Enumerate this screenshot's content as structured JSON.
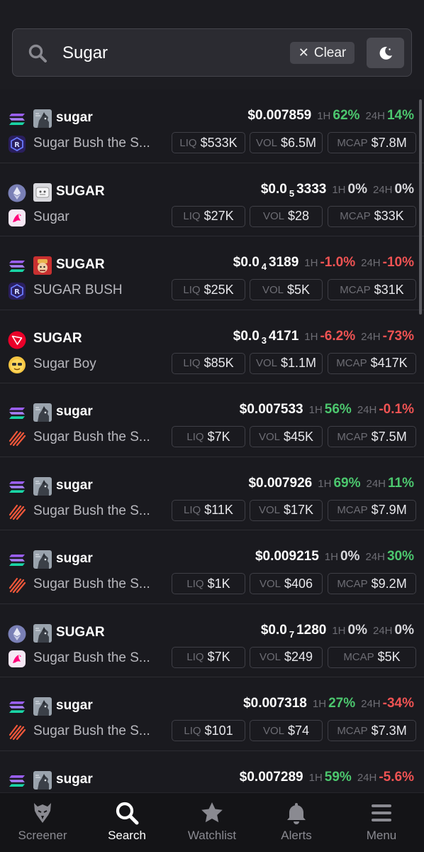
{
  "search": {
    "query": "Sugar",
    "clear_label": "Clear"
  },
  "rows": [
    {
      "chain": "solana",
      "dex": "raydium",
      "token_img": "dog",
      "symbol": "sugar",
      "name": "Sugar Bush the S...",
      "price_prefix": "$0.007859",
      "price_sub": "",
      "price_suffix": "",
      "h1_label": "1H",
      "h1": "62%",
      "h1_class": "pos",
      "h24_label": "24H",
      "h24": "14%",
      "h24_class": "pos",
      "liq_label": "LIQ",
      "liq": "$533K",
      "vol_label": "VOL",
      "vol": "$6.5M",
      "mcap_label": "MCAP",
      "mcap": "$7.8M"
    },
    {
      "chain": "ethereum",
      "dex": "uniswap",
      "token_img": "gray",
      "symbol": "SUGAR",
      "name": "Sugar",
      "price_prefix": "$0.0",
      "price_sub": "5",
      "price_suffix": "3333",
      "h1_label": "1H",
      "h1": "0%",
      "h1_class": "zero",
      "h24_label": "24H",
      "h24": "0%",
      "h24_class": "zero",
      "liq_label": "LIQ",
      "liq": "$27K",
      "vol_label": "VOL",
      "vol": "$28",
      "mcap_label": "MCAP",
      "mcap": "$33K"
    },
    {
      "chain": "solana",
      "dex": "raydium",
      "token_img": "red",
      "symbol": "SUGAR",
      "name": "SUGAR BUSH",
      "price_prefix": "$0.0",
      "price_sub": "4",
      "price_suffix": "3189",
      "h1_label": "1H",
      "h1": "-1.0%",
      "h1_class": "neg",
      "h24_label": "24H",
      "h24": "-10%",
      "h24_class": "neg",
      "liq_label": "LIQ",
      "liq": "$25K",
      "vol_label": "VOL",
      "vol": "$5K",
      "mcap_label": "MCAP",
      "mcap": "$31K"
    },
    {
      "chain": "tron",
      "dex": "sunpump",
      "token_img": "",
      "symbol": "SUGAR",
      "name": "Sugar Boy",
      "price_prefix": "$0.0",
      "price_sub": "3",
      "price_suffix": "4171",
      "h1_label": "1H",
      "h1": "-6.2%",
      "h1_class": "neg",
      "h24_label": "24H",
      "h24": "-73%",
      "h24_class": "neg",
      "liq_label": "LIQ",
      "liq": "$85K",
      "vol_label": "VOL",
      "vol": "$1.1M",
      "mcap_label": "MCAP",
      "mcap": "$417K"
    },
    {
      "chain": "solana",
      "dex": "meteora",
      "token_img": "dog",
      "symbol": "sugar",
      "name": "Sugar Bush the S...",
      "price_prefix": "$0.007533",
      "price_sub": "",
      "price_suffix": "",
      "h1_label": "1H",
      "h1": "56%",
      "h1_class": "pos",
      "h24_label": "24H",
      "h24": "-0.1%",
      "h24_class": "neg",
      "liq_label": "LIQ",
      "liq": "$7K",
      "vol_label": "VOL",
      "vol": "$45K",
      "mcap_label": "MCAP",
      "mcap": "$7.5M"
    },
    {
      "chain": "solana",
      "dex": "meteora",
      "token_img": "dog",
      "symbol": "sugar",
      "name": "Sugar Bush the S...",
      "price_prefix": "$0.007926",
      "price_sub": "",
      "price_suffix": "",
      "h1_label": "1H",
      "h1": "69%",
      "h1_class": "pos",
      "h24_label": "24H",
      "h24": "11%",
      "h24_class": "pos",
      "liq_label": "LIQ",
      "liq": "$11K",
      "vol_label": "VOL",
      "vol": "$17K",
      "mcap_label": "MCAP",
      "mcap": "$7.9M"
    },
    {
      "chain": "solana",
      "dex": "meteora",
      "token_img": "dog",
      "symbol": "sugar",
      "name": "Sugar Bush the S...",
      "price_prefix": "$0.009215",
      "price_sub": "",
      "price_suffix": "",
      "h1_label": "1H",
      "h1": "0%",
      "h1_class": "zero",
      "h24_label": "24H",
      "h24": "30%",
      "h24_class": "pos",
      "liq_label": "LIQ",
      "liq": "$1K",
      "vol_label": "VOL",
      "vol": "$406",
      "mcap_label": "MCAP",
      "mcap": "$9.2M"
    },
    {
      "chain": "ethereum",
      "dex": "uniswap",
      "token_img": "dog",
      "symbol": "SUGAR",
      "name": "Sugar Bush the S...",
      "price_prefix": "$0.0",
      "price_sub": "7",
      "price_suffix": "1280",
      "h1_label": "1H",
      "h1": "0%",
      "h1_class": "zero",
      "h24_label": "24H",
      "h24": "0%",
      "h24_class": "zero",
      "liq_label": "LIQ",
      "liq": "$7K",
      "vol_label": "VOL",
      "vol": "$249",
      "mcap_label": "MCAP",
      "mcap": "$5K"
    },
    {
      "chain": "solana",
      "dex": "meteora",
      "token_img": "dog",
      "symbol": "sugar",
      "name": "Sugar Bush the S...",
      "price_prefix": "$0.007318",
      "price_sub": "",
      "price_suffix": "",
      "h1_label": "1H",
      "h1": "27%",
      "h1_class": "pos",
      "h24_label": "24H",
      "h24": "-34%",
      "h24_class": "neg",
      "liq_label": "LIQ",
      "liq": "$101",
      "vol_label": "VOL",
      "vol": "$74",
      "mcap_label": "MCAP",
      "mcap": "$7.3M"
    },
    {
      "chain": "solana",
      "dex": "meteora",
      "token_img": "dog",
      "symbol": "sugar",
      "name": "",
      "price_prefix": "$0.007289",
      "price_sub": "",
      "price_suffix": "",
      "h1_label": "1H",
      "h1": "59%",
      "h1_class": "pos",
      "h24_label": "24H",
      "h24": "-5.6%",
      "h24_class": "neg",
      "liq_label": "",
      "liq": "",
      "vol_label": "",
      "vol": "",
      "mcap_label": "",
      "mcap": ""
    }
  ],
  "nav": [
    {
      "label": "Screener",
      "icon": "eagle-icon",
      "active": false
    },
    {
      "label": "Search",
      "icon": "search-icon",
      "active": true
    },
    {
      "label": "Watchlist",
      "icon": "star-icon",
      "active": false
    },
    {
      "label": "Alerts",
      "icon": "bell-icon",
      "active": false
    },
    {
      "label": "Menu",
      "icon": "menu-icon",
      "active": false
    }
  ],
  "colors": {
    "positive": "#4cc76e",
    "negative": "#ef5353",
    "background": "#1a1a1f"
  }
}
